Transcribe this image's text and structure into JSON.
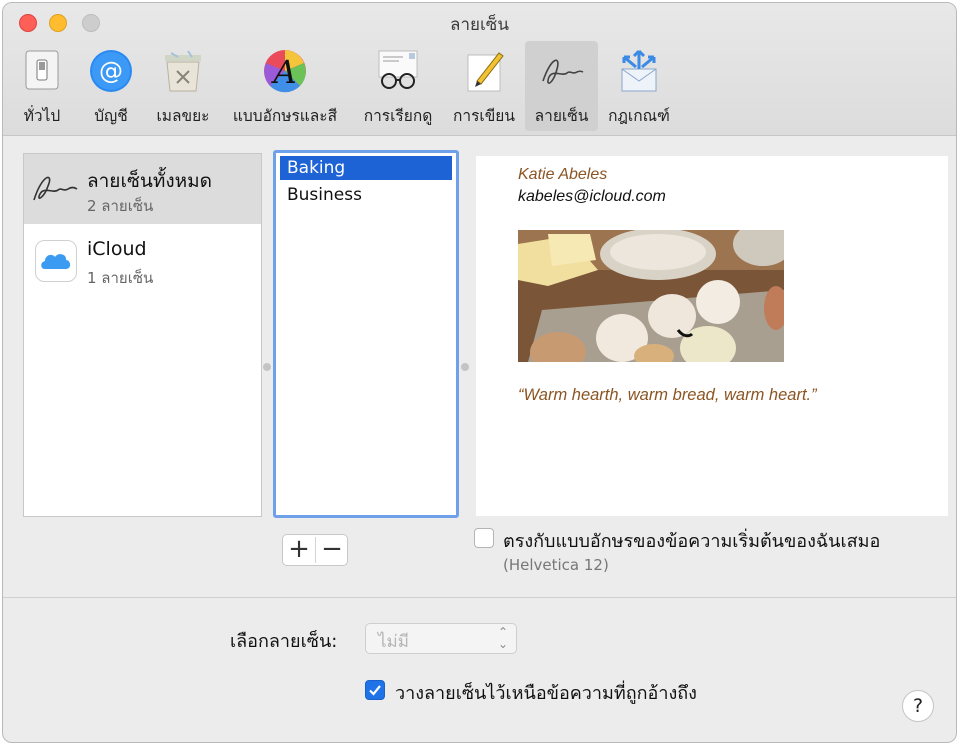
{
  "window": {
    "title": "ลายเซ็น"
  },
  "toolbar": {
    "items": [
      {
        "label": "ทั่วไป",
        "icon": "switch-icon"
      },
      {
        "label": "บัญชี",
        "icon": "at-sign-icon"
      },
      {
        "label": "เมลขยะ",
        "icon": "junk-bin-icon"
      },
      {
        "label": "แบบอักษรและสี",
        "icon": "font-color-icon"
      },
      {
        "label": "การเรียกดู",
        "icon": "glasses-icon"
      },
      {
        "label": "การเขียน",
        "icon": "pencil-note-icon"
      },
      {
        "label": "ลายเซ็น",
        "icon": "signature-icon"
      },
      {
        "label": "กฎเกณฑ์",
        "icon": "rules-envelope-icon"
      }
    ],
    "active": "ลายเซ็น"
  },
  "accounts": [
    {
      "name": "ลายเซ็นทั้งหมด",
      "count": "2 ลายเซ็น",
      "icon": "signature-icon",
      "selected": true
    },
    {
      "name": "iCloud",
      "count": "1 ลายเซ็น",
      "icon": "icloud-icon",
      "selected": false
    }
  ],
  "signatures": [
    {
      "name": "Baking",
      "selected": true
    },
    {
      "name": "Business",
      "selected": false
    }
  ],
  "preview": {
    "name": "Katie Abeles",
    "email": "kabeles@icloud.com",
    "image": "eggs-and-butter-photo",
    "quote": "“Warm hearth, warm bread, warm heart.”"
  },
  "controls": {
    "add": "+",
    "remove": "−",
    "match_font_label": "ตรงกับแบบอักษรของข้อความเริ่มต้นของฉันเสมอ",
    "match_font_checked": false,
    "font_hint": "(Helvetica 12)",
    "choose_signature_label": "เลือกลายเซ็น:",
    "choose_signature_value": "ไม่มี",
    "place_above_label": "วางลายเซ็นไว้เหนือข้อความที่ถูกอ้างถึง",
    "place_above_checked": true,
    "help": "?"
  },
  "colors": {
    "selection": "#1d63d6",
    "accent_focus": "#6fa1ea",
    "signature_text": "#8b5422"
  }
}
